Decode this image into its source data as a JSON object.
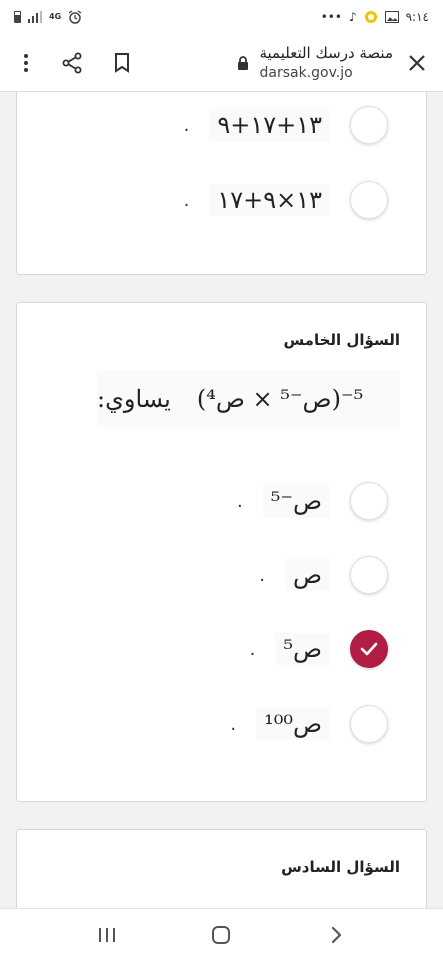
{
  "status": {
    "time": "٩:١٤",
    "network": "4G",
    "dots": "•••"
  },
  "browser": {
    "title": "منصة درسك التعليمية",
    "domain": "darsak.gov.jo"
  },
  "card1": {
    "options": [
      {
        "text": "١٣+١٧+٩",
        "selected": false
      },
      {
        "text": "١٣×٩+١٧",
        "selected": false
      }
    ]
  },
  "card2": {
    "title": "السؤال الخامس",
    "stem_expr": "(ص⁻⁵ × ص⁴)⁻⁵",
    "stem_word": "يساوي:",
    "options": [
      {
        "text": "ص⁻⁵",
        "selected": false
      },
      {
        "text": "ص",
        "selected": false
      },
      {
        "text": "ص⁵",
        "selected": true
      },
      {
        "text": "ص¹⁰⁰",
        "selected": false
      }
    ]
  },
  "card3": {
    "title": "السؤال السادس"
  },
  "colors": {
    "accent": "#b21d44"
  }
}
